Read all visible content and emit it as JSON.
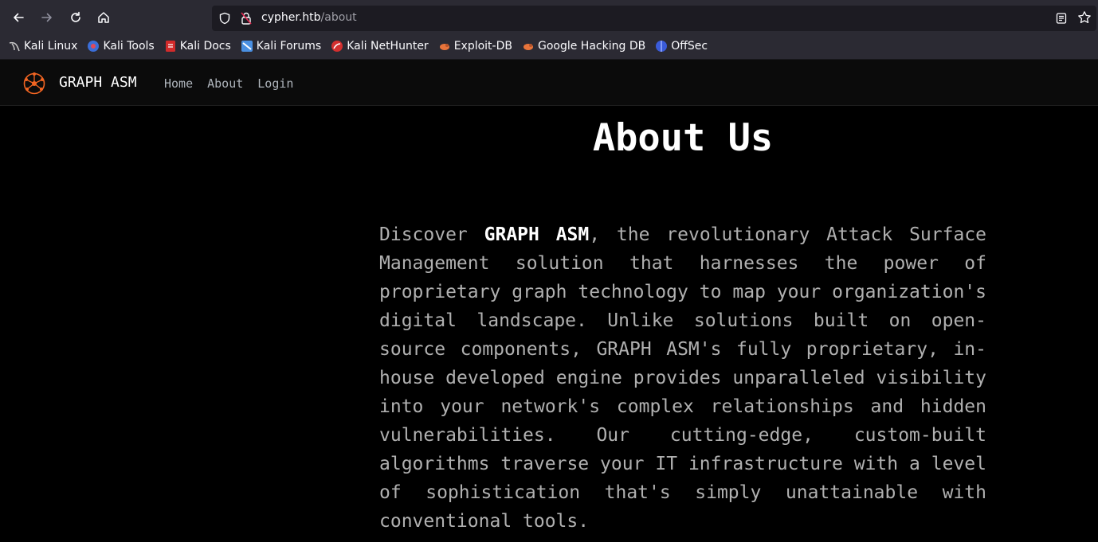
{
  "browser": {
    "url_host": "cypher.htb",
    "url_path": "/about"
  },
  "bookmarks": [
    {
      "label": "Kali Linux",
      "icon": "kali-dragon-icon"
    },
    {
      "label": "Kali Tools",
      "icon": "kali-tools-icon"
    },
    {
      "label": "Kali Docs",
      "icon": "kali-docs-icon"
    },
    {
      "label": "Kali Forums",
      "icon": "kali-forums-icon"
    },
    {
      "label": "Kali NetHunter",
      "icon": "kali-nethunter-icon"
    },
    {
      "label": "Exploit-DB",
      "icon": "exploit-db-icon"
    },
    {
      "label": "Google Hacking DB",
      "icon": "ghdb-icon"
    },
    {
      "label": "OffSec",
      "icon": "offsec-icon"
    }
  ],
  "site": {
    "brand": "GRAPH ASM",
    "nav": [
      "Home",
      "About",
      "Login"
    ],
    "accent_color": "#f26522"
  },
  "about": {
    "title": "About Us",
    "intro": "Discover ",
    "brand_bold": "GRAPH ASM",
    "body": ", the revolutionary Attack Surface Management solution that harnesses the power of proprietary graph technology to map your organization's digital landscape. Unlike solutions built on open-source components, GRAPH ASM's fully proprietary, in-house developed engine provides unparalleled visibility into your network's complex relationships and hidden vulnerabilities. Our cutting-edge, custom-built algorithms traverse your IT infrastructure with a level of sophistication that's simply unattainable with conventional tools."
  }
}
